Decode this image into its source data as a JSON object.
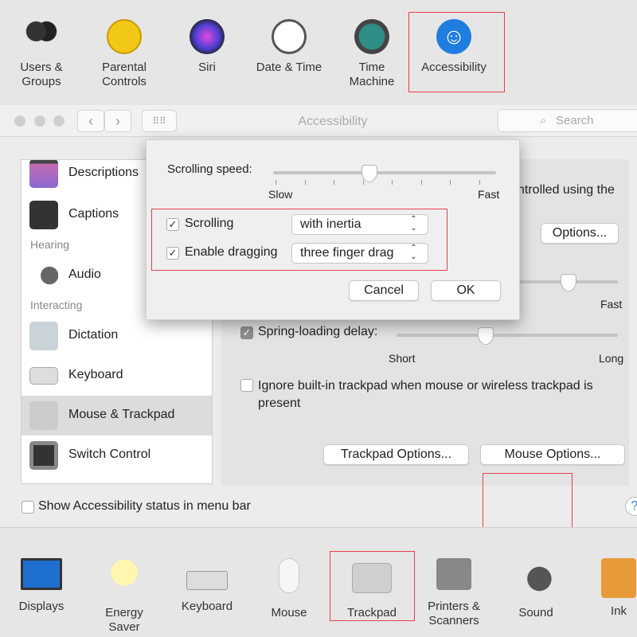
{
  "top_prefs": [
    {
      "label": "Users &\nGroups",
      "icon": "users-icon"
    },
    {
      "label": "Parental\nControls",
      "icon": "parental-controls-icon"
    },
    {
      "label": "Siri",
      "icon": "siri-icon"
    },
    {
      "label": "Date & Time",
      "icon": "clock-calendar-icon"
    },
    {
      "label": "Time\nMachine",
      "icon": "time-machine-icon"
    },
    {
      "label": "Accessibility",
      "icon": "accessibility-icon"
    }
  ],
  "window": {
    "title": "Accessibility",
    "search_placeholder": "Search"
  },
  "sidebar": {
    "items": [
      {
        "label": "Descriptions"
      },
      {
        "label": "Captions"
      },
      {
        "label": "Audio"
      },
      {
        "label": "Dictation"
      },
      {
        "label": "Keyboard"
      },
      {
        "label": "Mouse & Trackpad",
        "selected": true
      },
      {
        "label": "Switch Control"
      }
    ],
    "headers": [
      "Hearing",
      "Interacting"
    ]
  },
  "pane": {
    "partial_text": "ntrolled using the",
    "options_label": "Options...",
    "fast_label": "Fast",
    "spring_loading": {
      "label": "Spring-loading delay:",
      "checked": true,
      "min_label": "Short",
      "max_label": "Long",
      "value_fraction": 0.4
    },
    "ignore_trackpad": {
      "label": "Ignore built-in trackpad when mouse or wireless trackpad is present",
      "checked": false
    },
    "trackpad_options": "Trackpad Options...",
    "mouse_options": "Mouse Options..."
  },
  "sheet": {
    "scrolling_speed": {
      "label": "Scrolling speed:",
      "min_label": "Slow",
      "max_label": "Fast",
      "value_fraction": 0.43
    },
    "scrolling": {
      "label": "Scrolling",
      "checked": true,
      "value": "with inertia"
    },
    "dragging": {
      "label": "Enable dragging",
      "checked": true,
      "value": "three finger drag"
    },
    "cancel": "Cancel",
    "ok": "OK"
  },
  "status_checkbox": {
    "label": "Show Accessibility status in menu bar",
    "checked": false
  },
  "help": "?",
  "bottom_prefs": [
    {
      "label": "Displays",
      "icon": "display-icon"
    },
    {
      "label": "Energy\nSaver",
      "icon": "lightbulb-icon"
    },
    {
      "label": "Keyboard",
      "icon": "keyboard-icon"
    },
    {
      "label": "Mouse",
      "icon": "mouse-icon"
    },
    {
      "label": "Trackpad",
      "icon": "trackpad-icon"
    },
    {
      "label": "Printers &\nScanners",
      "icon": "printer-icon"
    },
    {
      "label": "Sound",
      "icon": "speaker-icon"
    },
    {
      "label": "Ink",
      "icon": "ink-icon"
    }
  ],
  "colors": {
    "highlight": "#e8414a",
    "accessibility_blue": "#1f7de0"
  }
}
